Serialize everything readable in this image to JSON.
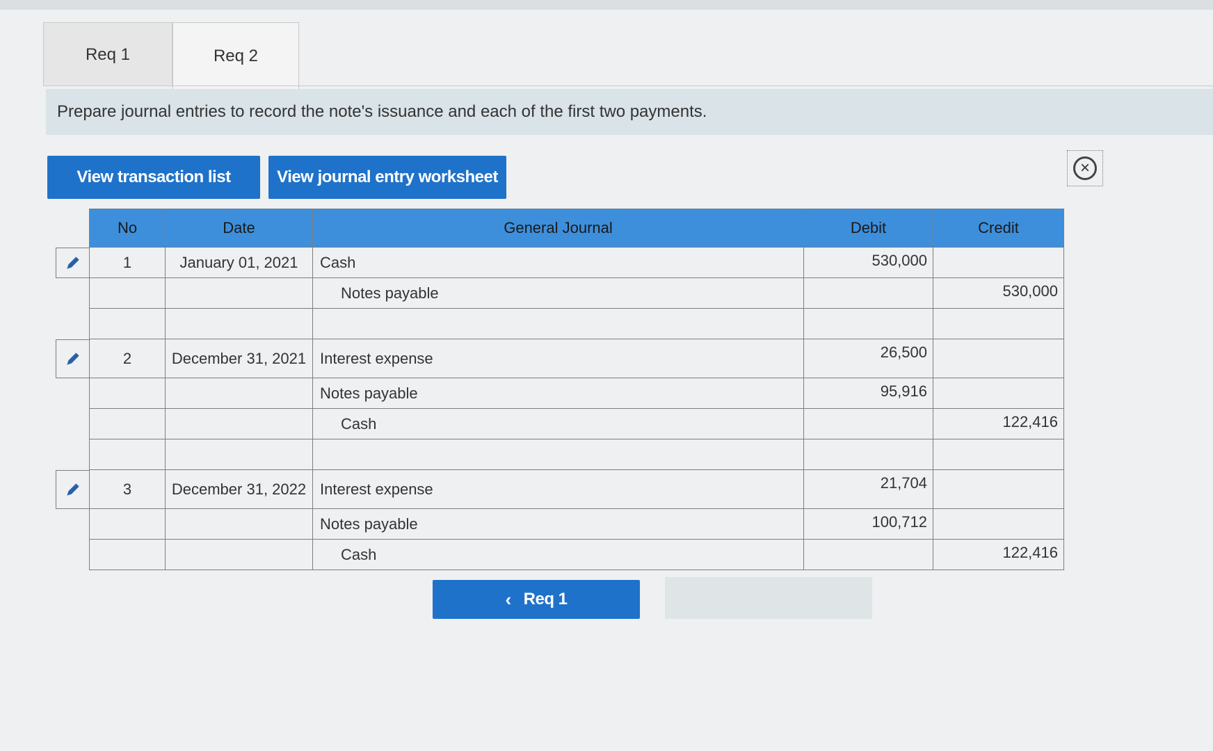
{
  "tabs": [
    {
      "label": "Req 1"
    },
    {
      "label": "Req 2"
    }
  ],
  "instruction": "Prepare journal entries to record the note's issuance and each of the first two payments.",
  "buttons": {
    "view_transaction_list": "View transaction list",
    "view_journal_entry_worksheet": "View journal entry worksheet",
    "prev_req": "Req 1"
  },
  "icons": {
    "close": "close-circle-icon",
    "edit": "pencil-icon",
    "prev": "chevron-left-icon"
  },
  "colors": {
    "accent_blue": "#1f72c9",
    "header_blue": "#3d8fdc",
    "instruction_bg": "#d9e3e8"
  },
  "journal": {
    "headers": {
      "no": "No",
      "date": "Date",
      "account": "General Journal",
      "debit": "Debit",
      "credit": "Credit"
    },
    "rows": [
      {
        "no": "1",
        "date": "January 01, 2021",
        "account": "Cash",
        "debit": "530,000",
        "credit": ""
      },
      {
        "no": "",
        "date": "",
        "account": "Notes payable",
        "debit": "",
        "credit": "530,000"
      },
      {
        "no": "",
        "date": "",
        "account": "",
        "debit": "",
        "credit": ""
      },
      {
        "no": "2",
        "date": "December 31, 2021",
        "account": "Interest expense",
        "debit": "26,500",
        "credit": ""
      },
      {
        "no": "",
        "date": "",
        "account": "Notes payable",
        "debit": "95,916",
        "credit": ""
      },
      {
        "no": "",
        "date": "",
        "account": "Cash",
        "debit": "",
        "credit": "122,416"
      },
      {
        "no": "",
        "date": "",
        "account": "",
        "debit": "",
        "credit": ""
      },
      {
        "no": "3",
        "date": "December 31, 2022",
        "account": "Interest expense",
        "debit": "21,704",
        "credit": ""
      },
      {
        "no": "",
        "date": "",
        "account": "Notes payable",
        "debit": "100,712",
        "credit": ""
      },
      {
        "no": "",
        "date": "",
        "account": "Cash",
        "debit": "",
        "credit": "122,416"
      }
    ]
  }
}
